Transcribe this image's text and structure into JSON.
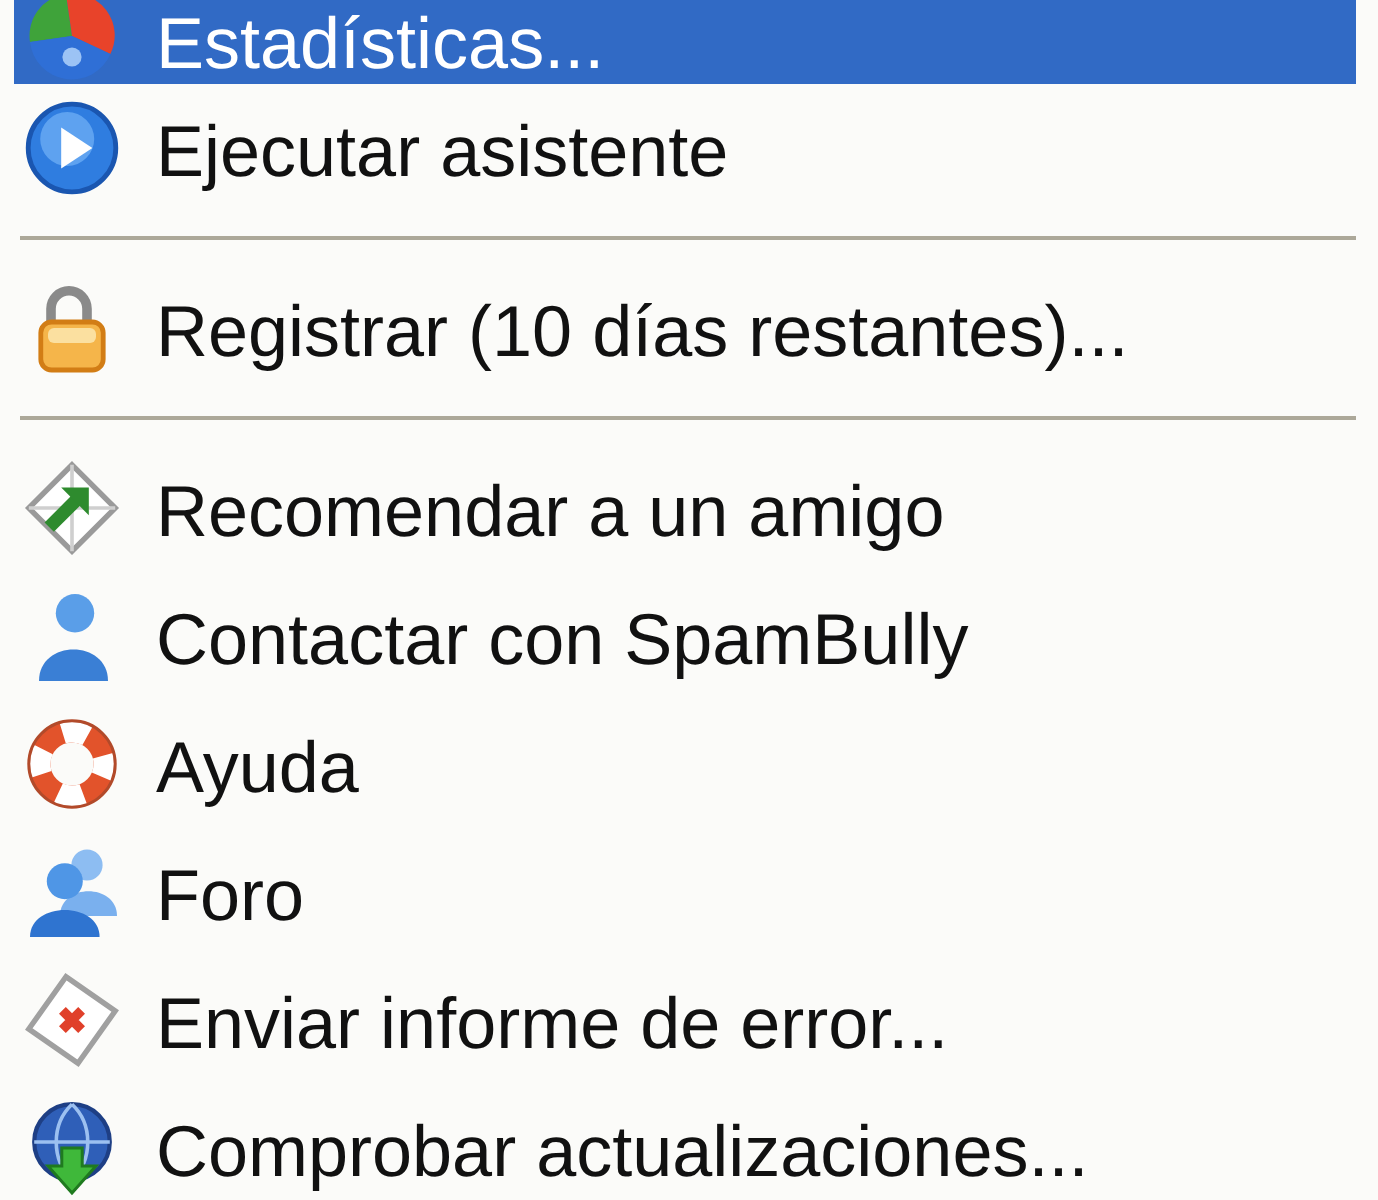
{
  "menu": {
    "items": [
      {
        "kind": "item",
        "label": "Estadísticas...",
        "selected": true
      },
      {
        "kind": "item",
        "label": "Ejecutar asistente",
        "selected": false
      },
      {
        "kind": "separator"
      },
      {
        "kind": "item",
        "label": "Registrar (10 días restantes)...",
        "selected": false
      },
      {
        "kind": "separator"
      },
      {
        "kind": "item",
        "label": "Recomendar a un amigo",
        "selected": false
      },
      {
        "kind": "item",
        "label": "Contactar con SpamBully",
        "selected": false
      },
      {
        "kind": "item",
        "label": "Ayuda",
        "selected": false
      },
      {
        "kind": "item",
        "label": "Foro",
        "selected": false
      },
      {
        "kind": "item",
        "label": "Enviar informe de error...",
        "selected": false
      },
      {
        "kind": "item",
        "label": "Comprobar actualizaciones...",
        "selected": false
      }
    ]
  }
}
